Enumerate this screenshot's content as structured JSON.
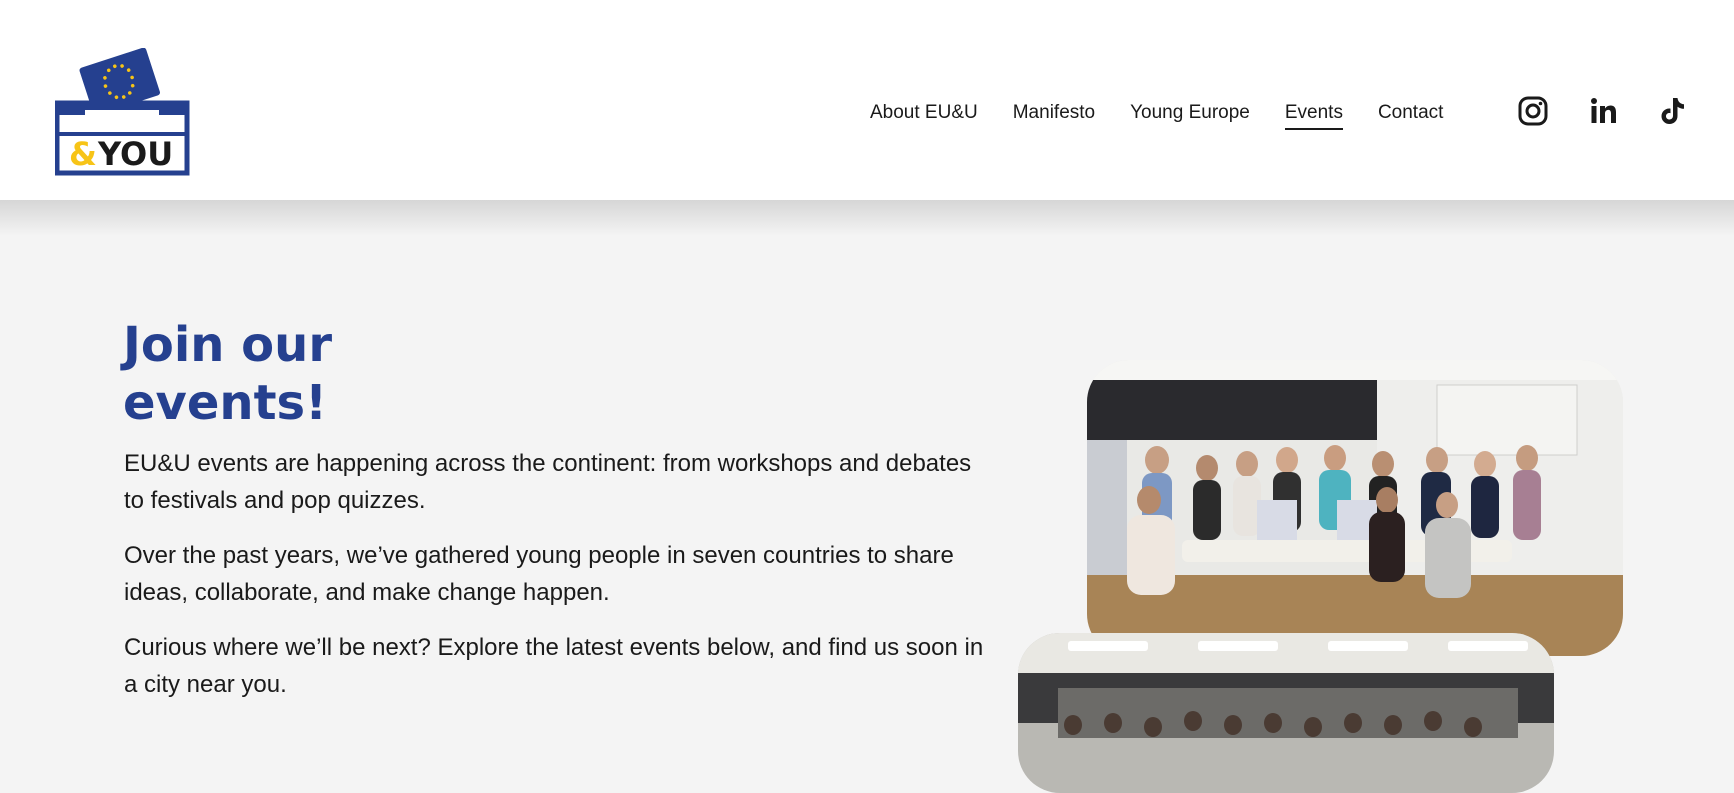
{
  "logo": {
    "text": "& YOU",
    "amp": "&",
    "you": "YOU"
  },
  "nav": {
    "items": [
      {
        "label": "About EU&U"
      },
      {
        "label": "Manifesto"
      },
      {
        "label": "Young Europe"
      },
      {
        "label": "Events"
      },
      {
        "label": "Contact"
      }
    ],
    "active": "Events"
  },
  "social": [
    "instagram-icon",
    "linkedin-icon",
    "tiktok-icon"
  ],
  "hero": {
    "title_line1": "Join our",
    "title_line2": "events!",
    "paragraphs": [
      "EU&U events are happening across the continent: from workshops and debates to festivals and pop quizzes.",
      "Over the past years, we’ve gathered young people in seven countries to share ideas, collaborate, and make change happen.",
      "Curious where we’ll be next? Explore the latest events below, and find us soon in a city near you."
    ]
  },
  "colors": {
    "brand_blue": "#25408f",
    "accent_yellow": "#f7c417",
    "text": "#1a1a1a",
    "background": "#f4f4f4"
  }
}
